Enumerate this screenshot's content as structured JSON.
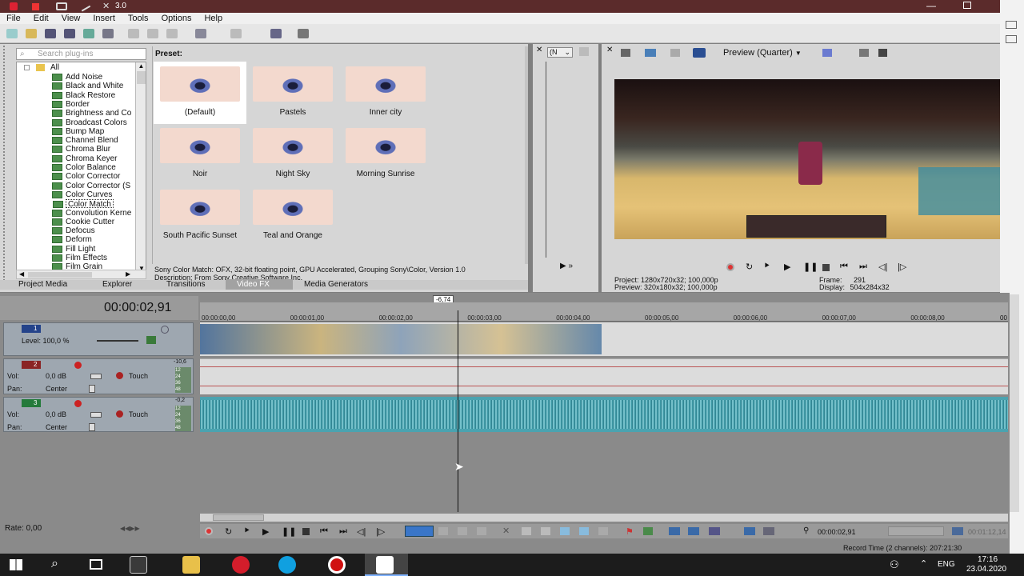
{
  "window": {
    "title": "3.0"
  },
  "menu": [
    "File",
    "Edit",
    "View",
    "Insert",
    "Tools",
    "Options",
    "Help"
  ],
  "left_panel": {
    "search_placeholder": "Search plug-ins",
    "tree_root": "All",
    "plugins": [
      "Add Noise",
      "Black and White",
      "Black Restore",
      "Border",
      "Brightness and Co",
      "Broadcast Colors",
      "Bump Map",
      "Channel Blend",
      "Chroma Blur",
      "Chroma Keyer",
      "Color Balance",
      "Color Corrector",
      "Color Corrector (S",
      "Color Curves",
      "Color Match",
      "Convolution Kerne",
      "Cookie Cutter",
      "Defocus",
      "Deform",
      "Fill Light",
      "Film Effects",
      "Film Grain"
    ],
    "selected_plugin": "Color Match",
    "preset_label": "Preset:",
    "presets": [
      "(Default)",
      "Pastels",
      "Inner city",
      "Noir",
      "Night Sky",
      "Morning Sunrise",
      "South Pacific Sunset",
      "Teal and Orange"
    ],
    "description_line1": "Sony Color Match: OFX, 32-bit floating point, GPU Accelerated, Grouping Sony\\Color, Version 1.0",
    "description_line2": "Description: From Sony Creative Software Inc.",
    "tabs": [
      "Project Media",
      "Explorer",
      "Transitions",
      "Video FX",
      "Media Generators"
    ],
    "active_tab": "Video FX"
  },
  "trimmer": {
    "dropdown": "(N"
  },
  "preview": {
    "mode": "Preview (Quarter)",
    "project_label": "Project:",
    "project_value": "1280x720x32; 100,000p",
    "preview_label": "Preview:",
    "preview_value": "320x180x32; 100,000p",
    "frame_label": "Frame:",
    "frame_value": "291",
    "display_label": "Display:",
    "display_value": "504x284x32"
  },
  "timeline": {
    "timecode": "00:00:02,91",
    "cursor_marker": "-6,74",
    "ruler": [
      "00:00:00,00",
      "00:00:01,00",
      "00:00:02,00",
      "00:00:03,00",
      "00:00:04,00",
      "00:00:05,00",
      "00:00:06,00",
      "00:00:07,00",
      "00:00:08,00"
    ],
    "ruler_end": "00",
    "track1": {
      "number": "1",
      "level_label": "Level: 100,0 %"
    },
    "track2": {
      "number": "2",
      "vol_label": "Vol:",
      "vol_value": "0,0 dB",
      "pan_label": "Pan:",
      "pan_value": "Center",
      "touch": "Touch",
      "meter_top": "-10,6",
      "meter_scale": [
        "12",
        "24",
        "36",
        "48"
      ]
    },
    "track3": {
      "number": "3",
      "vol_label": "Vol:",
      "vol_value": "0,0 dB",
      "pan_label": "Pan:",
      "pan_value": "Center",
      "touch": "Touch",
      "meter_top": "-0,2",
      "meter_scale": [
        "12",
        "24",
        "36",
        "48"
      ]
    },
    "rate": "Rate: 0,00",
    "bottom_timecode": "00:00:02,91",
    "bottom_timecode_dim": "00:01:12,14",
    "record_time": "Record Time (2 channels): 207:21:30"
  },
  "taskbar": {
    "lang": "ENG",
    "time": "17:16",
    "date": "23.04.2020"
  },
  "colors": {
    "titlebar": "#5b2b2b",
    "track_bg": "#dcdcdc",
    "waveform": "#4aa3b0",
    "selection": "#0a64d8"
  }
}
